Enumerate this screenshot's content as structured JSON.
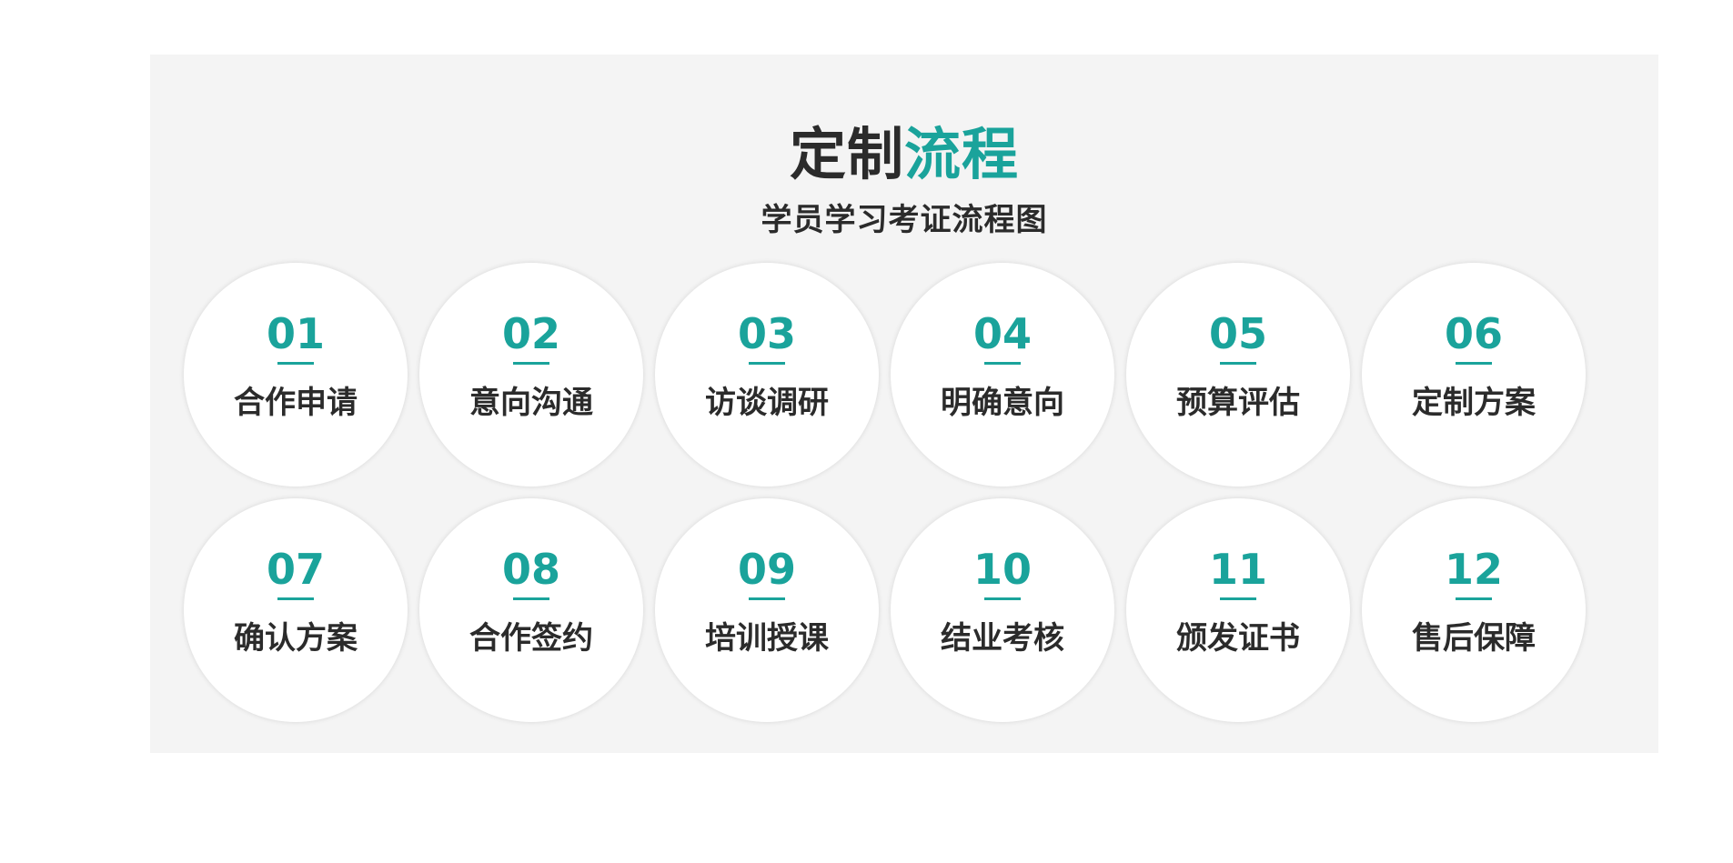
{
  "header": {
    "title_dark": "定制",
    "title_accent": "流程",
    "subtitle": "学员学习考证流程图"
  },
  "colors": {
    "accent": "#1aa39b",
    "text": "#2b2b2b",
    "panel_bg": "#f4f4f4",
    "circle_bg": "#ffffff"
  },
  "steps": [
    {
      "number": "01",
      "label": "合作申请"
    },
    {
      "number": "02",
      "label": "意向沟通"
    },
    {
      "number": "03",
      "label": "访谈调研"
    },
    {
      "number": "04",
      "label": "明确意向"
    },
    {
      "number": "05",
      "label": "预算评估"
    },
    {
      "number": "06",
      "label": "定制方案"
    },
    {
      "number": "07",
      "label": "确认方案"
    },
    {
      "number": "08",
      "label": "合作签约"
    },
    {
      "number": "09",
      "label": "培训授课"
    },
    {
      "number": "10",
      "label": "结业考核"
    },
    {
      "number": "11",
      "label": "颁发证书"
    },
    {
      "number": "12",
      "label": "售后保障"
    }
  ]
}
